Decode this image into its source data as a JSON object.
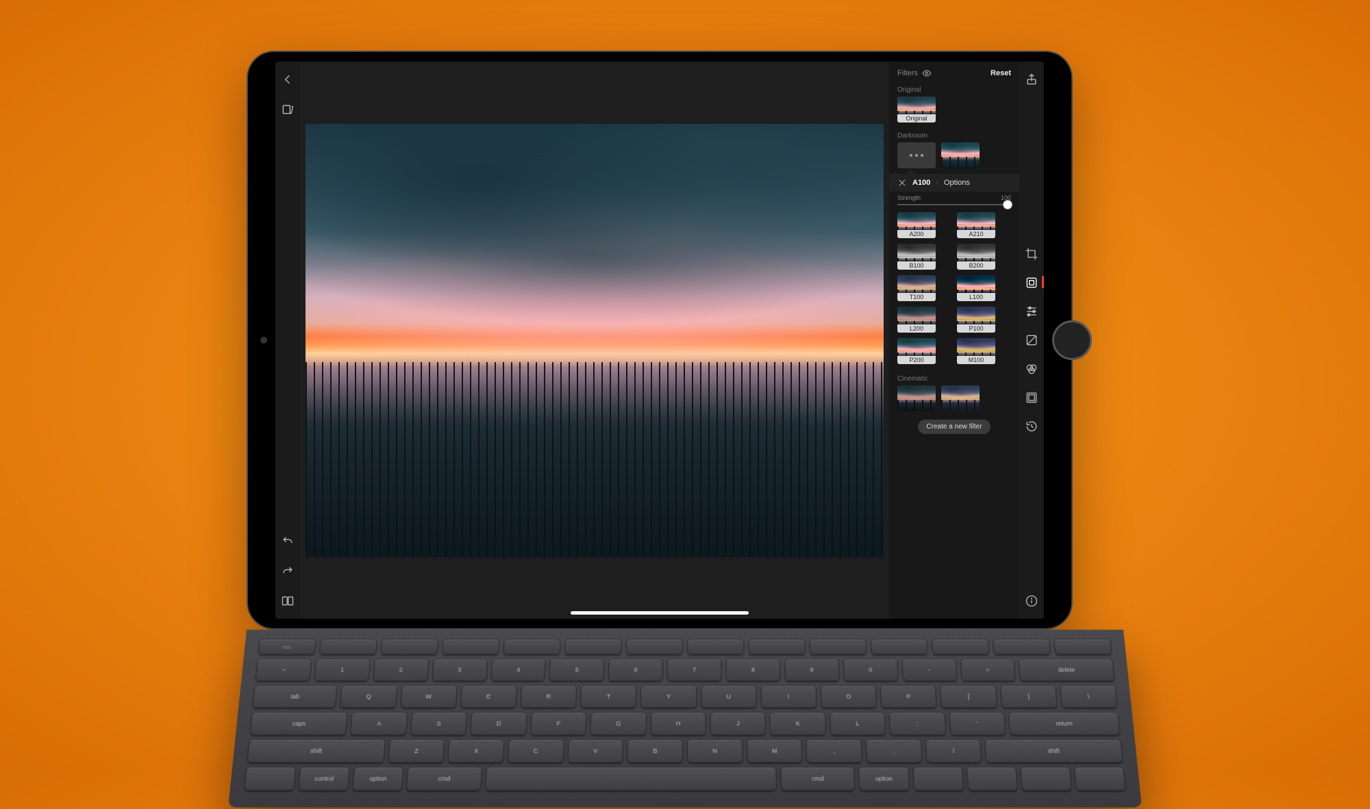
{
  "header": {
    "panel_title": "Filters",
    "reset": "Reset"
  },
  "sections": {
    "original": "Original",
    "darkroom": "Darkroom",
    "cinematic": "Cinematic"
  },
  "original_badge": "Original",
  "selected_filter": {
    "name": "A100",
    "options_label": "Options"
  },
  "strength": {
    "label": "Strength",
    "value": "100"
  },
  "filters": [
    {
      "label": "A200",
      "variant": "warm"
    },
    {
      "label": "A210",
      "variant": "warm"
    },
    {
      "label": "B100",
      "variant": "bw"
    },
    {
      "label": "B200",
      "variant": "bw"
    },
    {
      "label": "T100",
      "variant": "cool"
    },
    {
      "label": "L100",
      "variant": "hi"
    },
    {
      "label": "L200",
      "variant": "lo"
    },
    {
      "label": "P100",
      "variant": "purple"
    },
    {
      "label": "P200",
      "variant": "warm"
    },
    {
      "label": "M100",
      "variant": "purple"
    }
  ],
  "create_filter": "Create a new filter",
  "keyboard_rows": {
    "fn": [
      "esc",
      "",
      "",
      "",
      "",
      "",
      "",
      "",
      "",
      "",
      "",
      "",
      "",
      ""
    ],
    "r1": [
      "~",
      "1",
      "2",
      "3",
      "4",
      "5",
      "6",
      "7",
      "8",
      "9",
      "0",
      "-",
      "=",
      "delete"
    ],
    "r2": [
      "tab",
      "Q",
      "W",
      "E",
      "R",
      "T",
      "Y",
      "U",
      "I",
      "O",
      "P",
      "[",
      "]",
      "\\"
    ],
    "r3": [
      "caps",
      "A",
      "S",
      "D",
      "F",
      "G",
      "H",
      "J",
      "K",
      "L",
      ";",
      "'",
      "return"
    ],
    "r4": [
      "shift",
      "Z",
      "X",
      "C",
      "V",
      "B",
      "N",
      "M",
      ",",
      ".",
      "/",
      "shift"
    ],
    "r5": [
      "",
      "control",
      "option",
      "cmd",
      "",
      "cmd",
      "option",
      "",
      "",
      "",
      ""
    ]
  }
}
